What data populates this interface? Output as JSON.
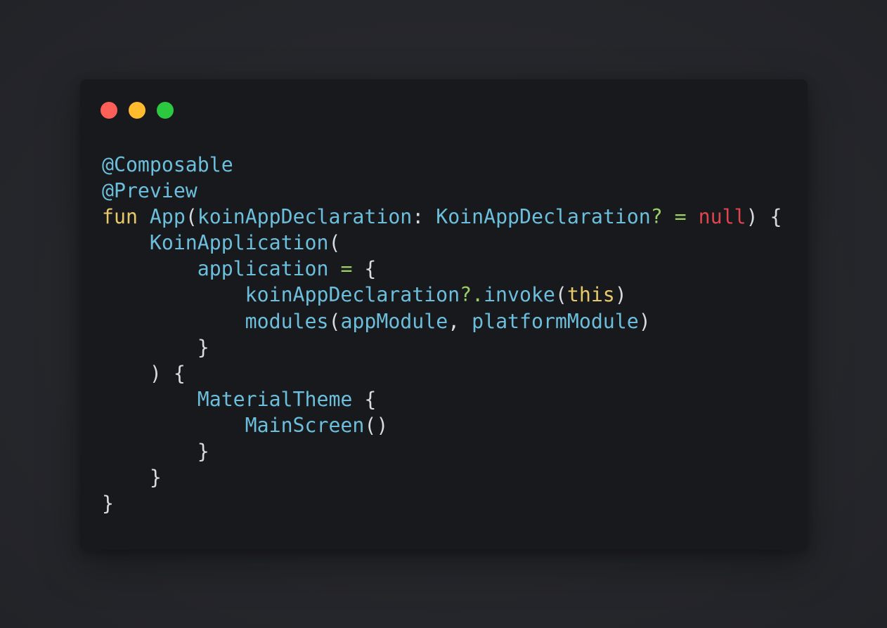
{
  "window": {
    "controls": [
      {
        "name": "close",
        "icon": "close-dot-icon",
        "color": "#fe5f57"
      },
      {
        "name": "minimize",
        "icon": "minimize-dot-icon",
        "color": "#febb2e"
      },
      {
        "name": "maximize",
        "icon": "maximize-dot-icon",
        "color": "#2bc840"
      }
    ]
  },
  "colors": {
    "background": "#25262b",
    "window": "#18191c",
    "keyword": "#e8c96a",
    "identifier": "#6cbfdc",
    "operator": "#9ccc65",
    "null_literal": "#e0454f",
    "punctuation": "#d7dadf"
  },
  "code": {
    "language": "kotlin",
    "lines": [
      [
        {
          "t": "@Composable",
          "c": "identifier"
        }
      ],
      [
        {
          "t": "@Preview",
          "c": "identifier"
        }
      ],
      [
        {
          "t": "fun",
          "c": "keyword"
        },
        {
          "t": " ",
          "c": "punctuation"
        },
        {
          "t": "App",
          "c": "identifier"
        },
        {
          "t": "(",
          "c": "punctuation"
        },
        {
          "t": "koinAppDeclaration",
          "c": "identifier"
        },
        {
          "t": ": ",
          "c": "punctuation"
        },
        {
          "t": "KoinAppDeclaration",
          "c": "identifier"
        },
        {
          "t": "?",
          "c": "operator"
        },
        {
          "t": " ",
          "c": "punctuation"
        },
        {
          "t": "=",
          "c": "operator"
        },
        {
          "t": " ",
          "c": "punctuation"
        },
        {
          "t": "null",
          "c": "null_literal"
        },
        {
          "t": ") {",
          "c": "punctuation"
        }
      ],
      [
        {
          "t": "    ",
          "c": "punctuation"
        },
        {
          "t": "KoinApplication",
          "c": "identifier"
        },
        {
          "t": "(",
          "c": "punctuation"
        }
      ],
      [
        {
          "t": "        ",
          "c": "punctuation"
        },
        {
          "t": "application",
          "c": "identifier"
        },
        {
          "t": " ",
          "c": "punctuation"
        },
        {
          "t": "=",
          "c": "operator"
        },
        {
          "t": " {",
          "c": "punctuation"
        }
      ],
      [
        {
          "t": "            ",
          "c": "punctuation"
        },
        {
          "t": "koinAppDeclaration",
          "c": "identifier"
        },
        {
          "t": "?.",
          "c": "operator"
        },
        {
          "t": "invoke",
          "c": "identifier"
        },
        {
          "t": "(",
          "c": "punctuation"
        },
        {
          "t": "this",
          "c": "keyword"
        },
        {
          "t": ")",
          "c": "punctuation"
        }
      ],
      [
        {
          "t": "            ",
          "c": "punctuation"
        },
        {
          "t": "modules",
          "c": "identifier"
        },
        {
          "t": "(",
          "c": "punctuation"
        },
        {
          "t": "appModule",
          "c": "identifier"
        },
        {
          "t": ", ",
          "c": "punctuation"
        },
        {
          "t": "platformModule",
          "c": "identifier"
        },
        {
          "t": ")",
          "c": "punctuation"
        }
      ],
      [
        {
          "t": "        }",
          "c": "punctuation"
        }
      ],
      [
        {
          "t": "    ) {",
          "c": "punctuation"
        }
      ],
      [
        {
          "t": "        ",
          "c": "punctuation"
        },
        {
          "t": "MaterialTheme",
          "c": "identifier"
        },
        {
          "t": " {",
          "c": "punctuation"
        }
      ],
      [
        {
          "t": "            ",
          "c": "punctuation"
        },
        {
          "t": "MainScreen",
          "c": "identifier"
        },
        {
          "t": "()",
          "c": "punctuation"
        }
      ],
      [
        {
          "t": "        }",
          "c": "punctuation"
        }
      ],
      [
        {
          "t": "    }",
          "c": "punctuation"
        }
      ],
      [
        {
          "t": "}",
          "c": "punctuation"
        }
      ]
    ]
  }
}
